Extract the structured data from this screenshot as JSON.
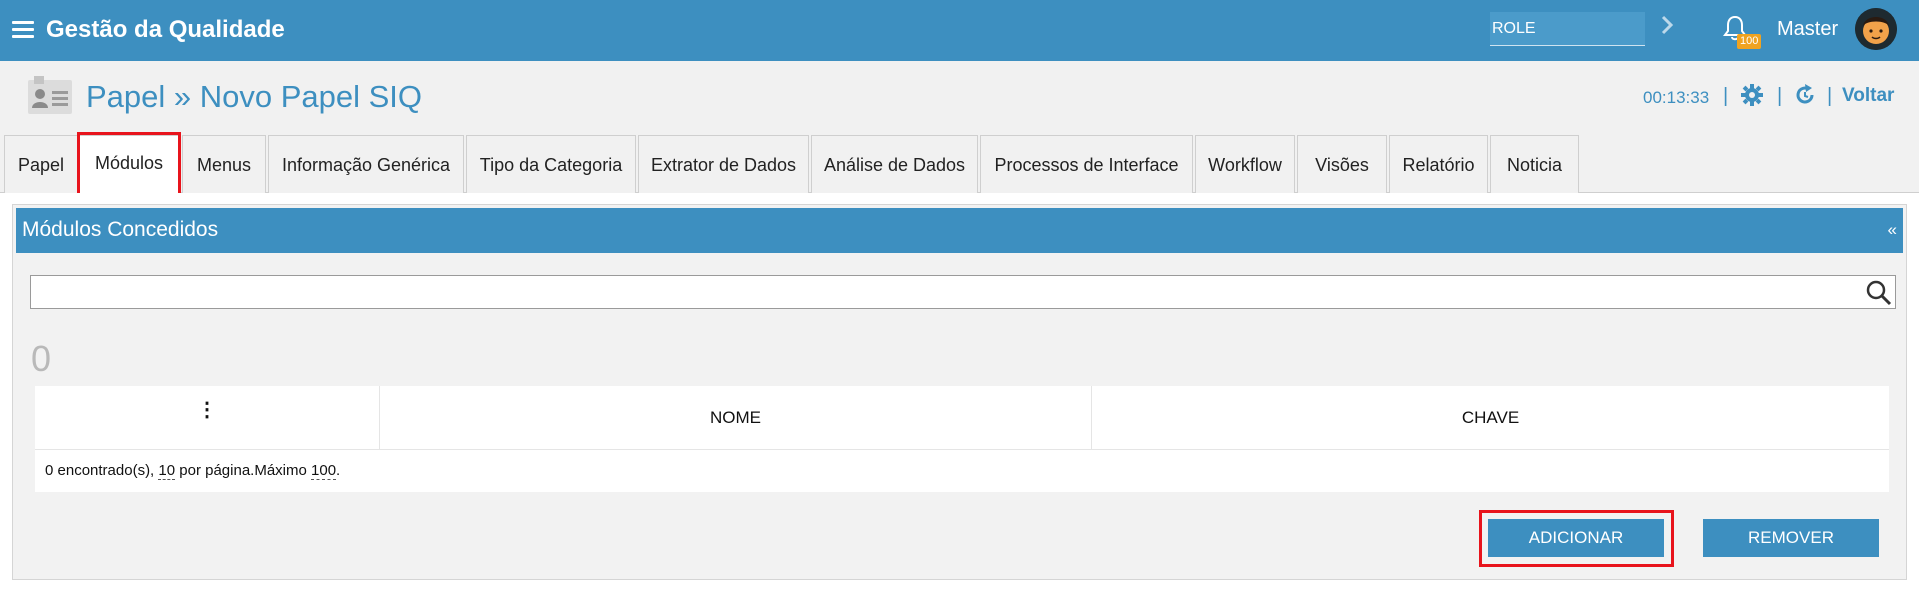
{
  "topbar": {
    "app_title": "Gestão da Qualidade",
    "role_value": "ROLE",
    "notification_count": "100",
    "user_name": "Master"
  },
  "header": {
    "title": "Papel » Novo Papel SIQ",
    "timer": "00:13:33",
    "back_label": "Voltar"
  },
  "tabs": [
    {
      "label": "Papel"
    },
    {
      "label": "Módulos"
    },
    {
      "label": "Menus"
    },
    {
      "label": "Informação Genérica"
    },
    {
      "label": "Tipo da Categoria"
    },
    {
      "label": "Extrator de Dados"
    },
    {
      "label": "Análise de Dados"
    },
    {
      "label": "Processos de Interface"
    },
    {
      "label": "Workflow"
    },
    {
      "label": "Visões"
    },
    {
      "label": "Relatório"
    },
    {
      "label": "Noticia"
    }
  ],
  "active_tab": "Módulos",
  "panel": {
    "title": "Módulos Concedidos",
    "collapse_glyph": "«",
    "search_value": "",
    "count": "0",
    "columns": {
      "actions": "⋮",
      "name": "NOME",
      "key": "CHAVE"
    },
    "footer": {
      "found": "0 encontrado(s),",
      "per_page_value": "10",
      "per_page_text": "por página.Máximo",
      "max_value": "100",
      "end": "."
    },
    "add_button": "ADICIONAR",
    "remove_button": "REMOVER"
  },
  "colors": {
    "primary": "#3d8fc0",
    "highlight": "#e8141c",
    "badge": "#f0a320"
  }
}
